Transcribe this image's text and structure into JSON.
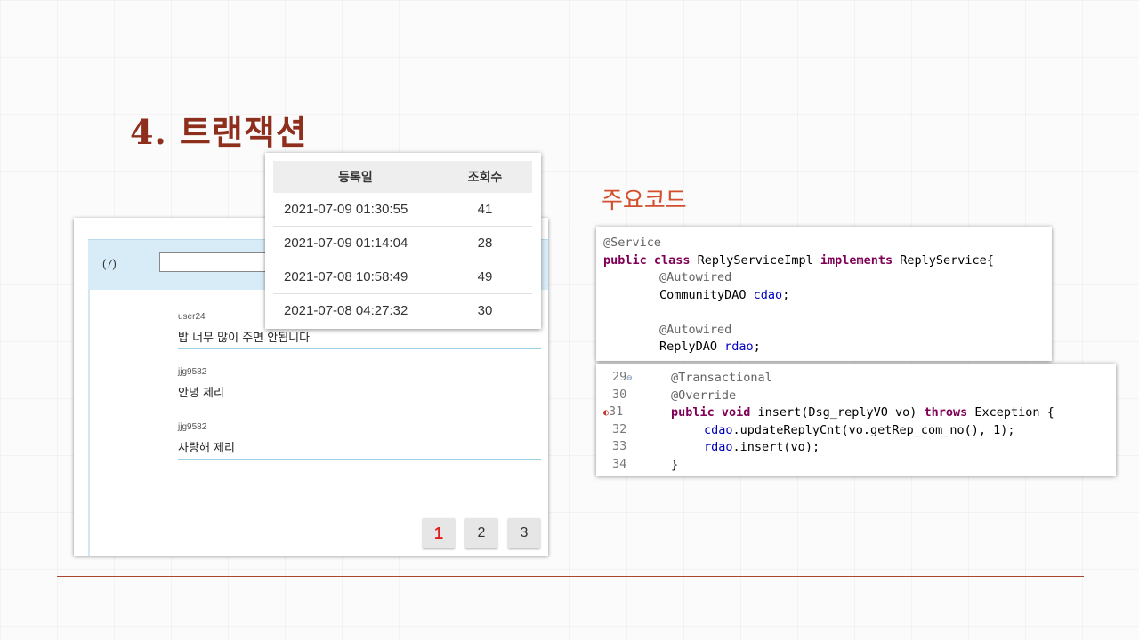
{
  "slide": {
    "title": "4. 트랜잭션",
    "subtitle": "주요코드"
  },
  "reply_panel": {
    "count_label": "(7)",
    "input_value": "",
    "replies": [
      {
        "user": "user24",
        "text": "밥 너무 많이 주면 안됩니다"
      },
      {
        "user": "jjg9582",
        "text": "안녕 제리"
      },
      {
        "user": "jjg9582",
        "text": "사랑해 제리"
      }
    ],
    "pages": [
      "1",
      "2",
      "3"
    ],
    "active_page": "1"
  },
  "date_table": {
    "headers": [
      "등록일",
      "조회수"
    ],
    "rows": [
      {
        "date": "2021-07-09 01:30:55",
        "views": "41"
      },
      {
        "date": "2021-07-09 01:14:04",
        "views": "28"
      },
      {
        "date": "2021-07-08 10:58:49",
        "views": "49"
      },
      {
        "date": "2021-07-08 04:27:32",
        "views": "30"
      }
    ]
  },
  "code_block_1": {
    "line1": "@Service",
    "line2_kw1": "public class",
    "line2_name": " ReplyServiceImpl ",
    "line2_kw2": "implements",
    "line2_rest": " ReplyService{",
    "line3": "@Autowired",
    "line4_type": "CommunityDAO ",
    "line4_field": "cdao",
    "line4_end": ";",
    "line5": "@Autowired",
    "line6_type": "ReplyDAO ",
    "line6_field": "rdao",
    "line6_end": ";"
  },
  "code_block_2": {
    "line_numbers": [
      "29",
      "30",
      "31",
      "32",
      "33",
      "34"
    ],
    "fold_marker": "⊖",
    "breakpoint_marker": "◐",
    "l29": "@Transactional",
    "l30": "@Override",
    "l31_kw1": "public void",
    "l31_mid1": " insert(Dsg_replyVO ",
    "l31_param": "vo",
    "l31_mid2": ") ",
    "l31_kw2": "throws",
    "l31_end": " Exception {",
    "l32_field": "cdao",
    "l32_mid": ".updateReplyCnt(",
    "l32_param": "vo",
    "l32_end": ".getRep_com_no(), 1);",
    "l33_field": "rdao",
    "l33_mid": ".insert(",
    "l33_param": "vo",
    "l33_end": ");",
    "l34": "}"
  },
  "colors": {
    "title": "#8e2e1c",
    "subtitle": "#d2502e",
    "keyword": "#7f0055",
    "field": "#0000c0",
    "annotation": "#646464"
  }
}
